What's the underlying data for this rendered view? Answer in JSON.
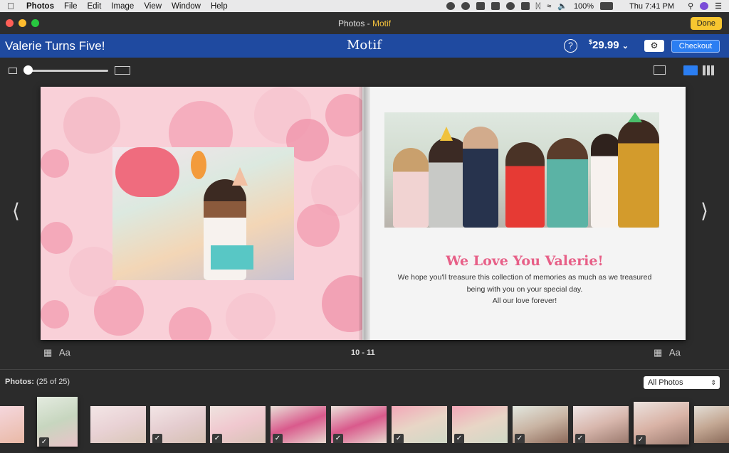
{
  "menubar": {
    "app": "Photos",
    "items": [
      "File",
      "Edit",
      "Image",
      "View",
      "Window",
      "Help"
    ],
    "battery": "100%",
    "clock": "Thu 7:41 PM"
  },
  "window": {
    "title_prefix": "Photos - ",
    "title_app": "Motif",
    "done_label": "Done"
  },
  "header": {
    "project_title": "Valerie Turns Five!",
    "brand": "Motif",
    "help": "?",
    "price_currency": "$",
    "price_value": "29.99",
    "checkout_label": "Checkout"
  },
  "page": {
    "headline": "We Love You Valerie!",
    "body_lines": [
      "We hope you'll treasure this collection of memories as much as we treasured",
      "being with you on your special day.",
      "All our love forever!"
    ],
    "page_numbers": "10 - 11",
    "text_tool": "Aa"
  },
  "strip": {
    "label_bold": "Photos:",
    "label_count": " (25 of 25)",
    "filter_value": "All Photos"
  },
  "colors": {
    "accent_blue": "#1f4aa0",
    "checkout": "#2b7ef2",
    "done": "#f7c630",
    "headline_pink": "#e75f87",
    "page_pink": "#f9d0d8"
  }
}
